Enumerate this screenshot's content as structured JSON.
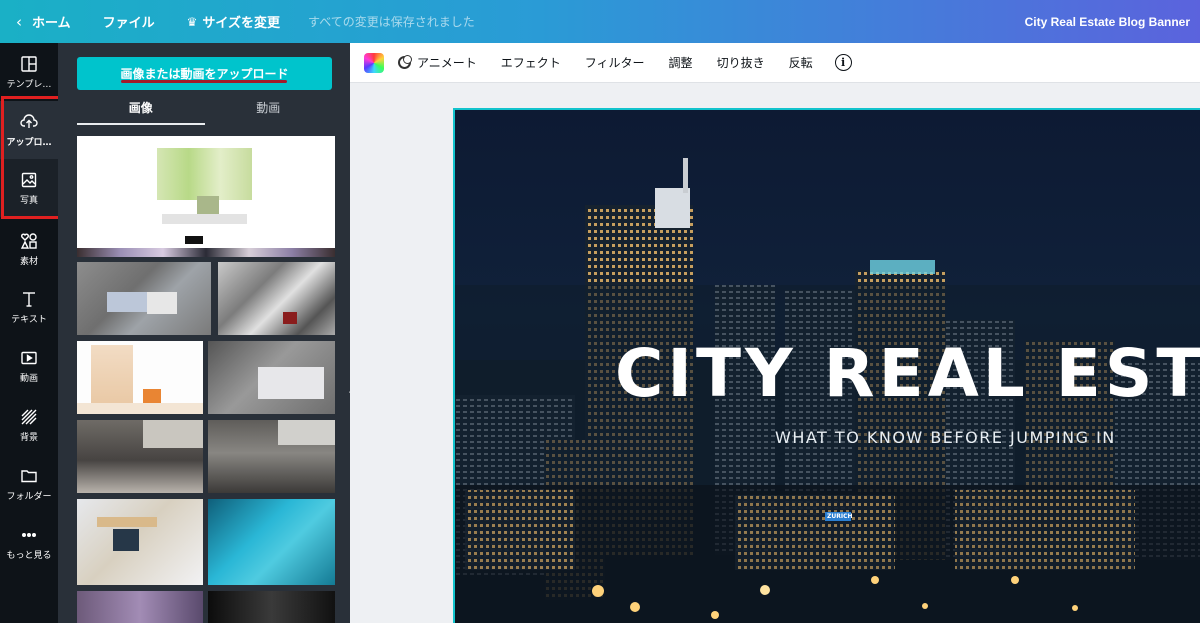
{
  "topbar": {
    "home": "ホーム",
    "file": "ファイル",
    "resize": "サイズを変更",
    "saved_status": "すべての変更は保存されました",
    "doc_title": "City Real Estate Blog Banner"
  },
  "rail": {
    "items": [
      {
        "label": "テンプレ…",
        "icon": "template-icon"
      },
      {
        "label": "アップロ…",
        "icon": "upload-cloud-icon"
      },
      {
        "label": "写真",
        "icon": "photo-icon"
      },
      {
        "label": "素材",
        "icon": "elements-icon"
      },
      {
        "label": "テキスト",
        "icon": "text-icon"
      },
      {
        "label": "動画",
        "icon": "video-icon"
      },
      {
        "label": "背景",
        "icon": "background-icon"
      },
      {
        "label": "フォルダー",
        "icon": "folder-icon"
      },
      {
        "label": "もっと見る",
        "icon": "more-icon"
      }
    ]
  },
  "panel": {
    "upload_button": "画像または動画をアップロード",
    "tabs": [
      "画像",
      "動画"
    ]
  },
  "toolbar": {
    "animate": "アニメート",
    "effect": "エフェクト",
    "filter": "フィルター",
    "adjust": "調整",
    "crop": "切り抜き",
    "flip": "反転"
  },
  "design": {
    "title": "CITY REAL ESTA",
    "subtitle": "WHAT TO KNOW BEFORE JUMPING IN",
    "sign": "ZURICH"
  },
  "colors": {
    "accent": "#00c4cc",
    "highlight_box": "#e02020",
    "rail_bg": "#0e1318",
    "panel_bg": "#293039"
  }
}
